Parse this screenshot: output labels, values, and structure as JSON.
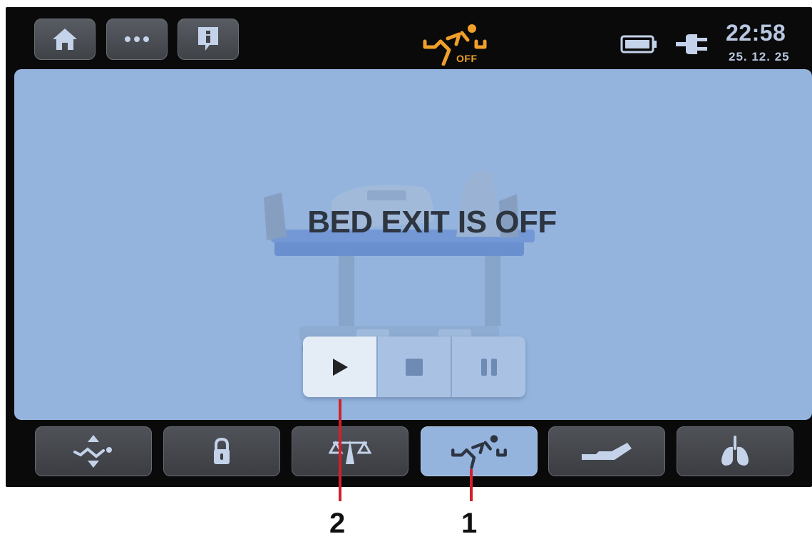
{
  "topbar": {
    "buttons": [
      {
        "name": "home-icon"
      },
      {
        "name": "more-icon"
      },
      {
        "name": "info-icon"
      }
    ],
    "status_icon": "bed-exit-icon",
    "status_label": "OFF",
    "battery_icon": "battery-icon",
    "power_icon": "power-plug-icon",
    "time": "22:58",
    "date": "25. 12. 25"
  },
  "main": {
    "message": "BED EXIT IS OFF",
    "controls": [
      {
        "icon": "play-icon",
        "active": true
      },
      {
        "icon": "stop-icon",
        "active": false
      },
      {
        "icon": "pause-icon",
        "active": false
      }
    ]
  },
  "bottom_nav": [
    {
      "icon": "height-adjust-icon",
      "active": false
    },
    {
      "icon": "lock-icon",
      "active": false
    },
    {
      "icon": "scale-icon",
      "active": false
    },
    {
      "icon": "bed-exit-icon",
      "active": true
    },
    {
      "icon": "bed-position-icon",
      "active": false
    },
    {
      "icon": "lungs-icon",
      "active": false
    }
  ],
  "callouts": [
    "2",
    "1"
  ],
  "colors": {
    "accent_orange": "#f0a02a",
    "panel_blue": "#94b4de",
    "callout_red": "#d1202b",
    "clock_text": "#b8c6e0"
  }
}
